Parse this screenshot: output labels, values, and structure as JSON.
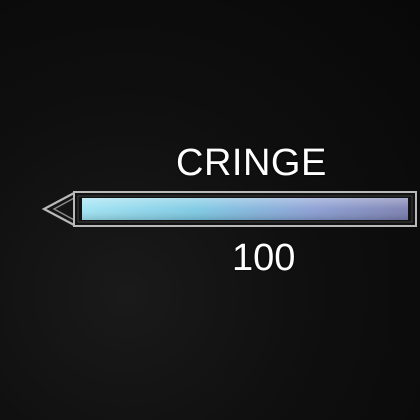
{
  "stat": {
    "label": "CRINGE",
    "value": "100",
    "fill_fraction": 1.0
  },
  "colors": {
    "background": "#0f0f0f",
    "frame": "#b9b9b9",
    "fill_start": "#8fd9ee",
    "fill_end": "#7f86b8",
    "text": "#ffffff"
  },
  "icons": {
    "bar_end": "arrow-left-icon"
  }
}
